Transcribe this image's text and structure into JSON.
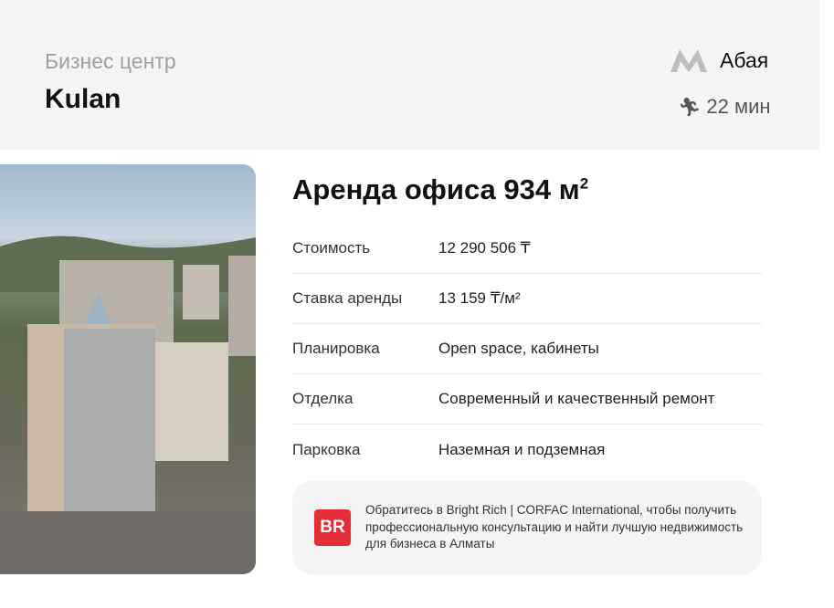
{
  "header": {
    "kind": "Бизнес центр",
    "name": "Kulan",
    "metro": "Абая",
    "walk_time": "22 мин"
  },
  "offer": {
    "title": "Аренда офиса 934 м",
    "title_sup": "2",
    "rows": [
      {
        "label": "Стоимость",
        "value": "12 290 506 ₸"
      },
      {
        "label": "Ставка аренды",
        "value": "13 159  ₸/м²"
      },
      {
        "label": "Планировка",
        "value": "Open space, кабинеты"
      },
      {
        "label": "Отделка",
        "value": "Современный и качественный ремонт"
      },
      {
        "label": "Парковка",
        "value": "Наземная и подземная"
      }
    ]
  },
  "cta": {
    "logo": "BR",
    "text": "Обратитесь в Bright Rich | CORFAC International, чтобы получить профессиональную консультацию и найти лучшую недвижимость для бизнеса в Алматы"
  },
  "colors": {
    "brand": "#e52d3a"
  }
}
